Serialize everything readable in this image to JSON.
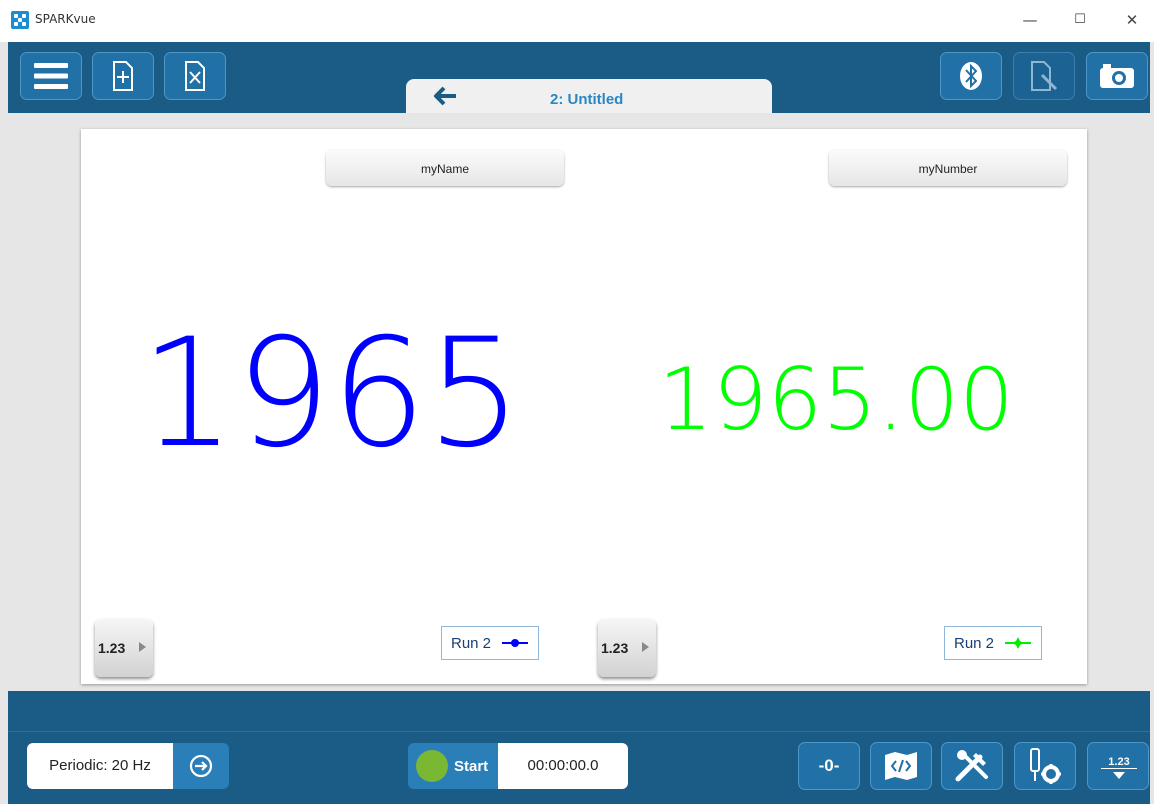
{
  "window": {
    "title": "SPARKvue",
    "minimize_glyph": "—",
    "maximize_glyph": "☐",
    "close_glyph": "✕"
  },
  "toolbar": {
    "left_buttons": [
      "menu-icon",
      "new-page-icon",
      "delete-page-icon"
    ],
    "right_buttons": [
      "bluetooth-icon",
      "annotation-icon",
      "camera-icon"
    ]
  },
  "page_tab": {
    "back_icon": "arrow-left-icon",
    "title": "2: Untitled"
  },
  "displays": [
    {
      "measurement": "myName",
      "value": "1965",
      "value_color": "#0000ff",
      "digits_label": "1.23",
      "run_label": "Run 2",
      "run_color": "#0000ff"
    },
    {
      "measurement": "myNumber",
      "value": "1965.00",
      "value_color": "#00ff00",
      "digits_label": "1.23",
      "run_label": "Run 2",
      "run_color": "#00ee00"
    }
  ],
  "bottom": {
    "sampling": "Periodic: 20 Hz",
    "start_label": "Start",
    "timer": "00:00:00.0",
    "zero_label": "-0-",
    "digits_tool_label": "1.23",
    "tool_icons": [
      "zero-sensor-icon",
      "code-icon",
      "tools-icon",
      "sensor-settings-icon",
      "digits-tool-icon"
    ]
  },
  "colors": {
    "bar_blue": "#1b5c86",
    "button_blue": "#2170a6",
    "start_green": "#7ab733",
    "tab_title_blue": "#2a87c5"
  }
}
